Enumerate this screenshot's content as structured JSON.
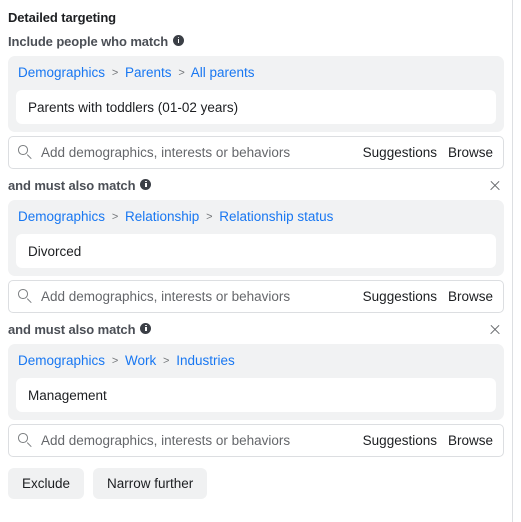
{
  "section": {
    "title": "Detailed targeting",
    "include_label": "Include people who match",
    "also_match_label": "and must also match"
  },
  "search": {
    "placeholder": "Add demographics, interests or behaviors",
    "suggestions_label": "Suggestions",
    "browse_label": "Browse"
  },
  "colors": {
    "link_blue": "#1877f2",
    "panel_grey": "#f1f2f3",
    "button_grey": "#f0f1f2",
    "text_dark": "#1c1e21",
    "text_muted": "#65676b"
  },
  "groups": [
    {
      "breadcrumb": [
        "Demographics",
        "Parents",
        "All parents"
      ],
      "separator": ">",
      "chips": [
        "Parents with toddlers (01-02 years)"
      ],
      "removable": false
    },
    {
      "breadcrumb": [
        "Demographics",
        "Relationship",
        "Relationship status"
      ],
      "separator": ">",
      "chips": [
        "Divorced"
      ],
      "removable": true
    },
    {
      "breadcrumb": [
        "Demographics",
        "Work",
        "Industries"
      ],
      "separator": ">",
      "chips": [
        "Management"
      ],
      "removable": true
    }
  ],
  "footer": {
    "exclude_label": "Exclude",
    "narrow_label": "Narrow further"
  }
}
